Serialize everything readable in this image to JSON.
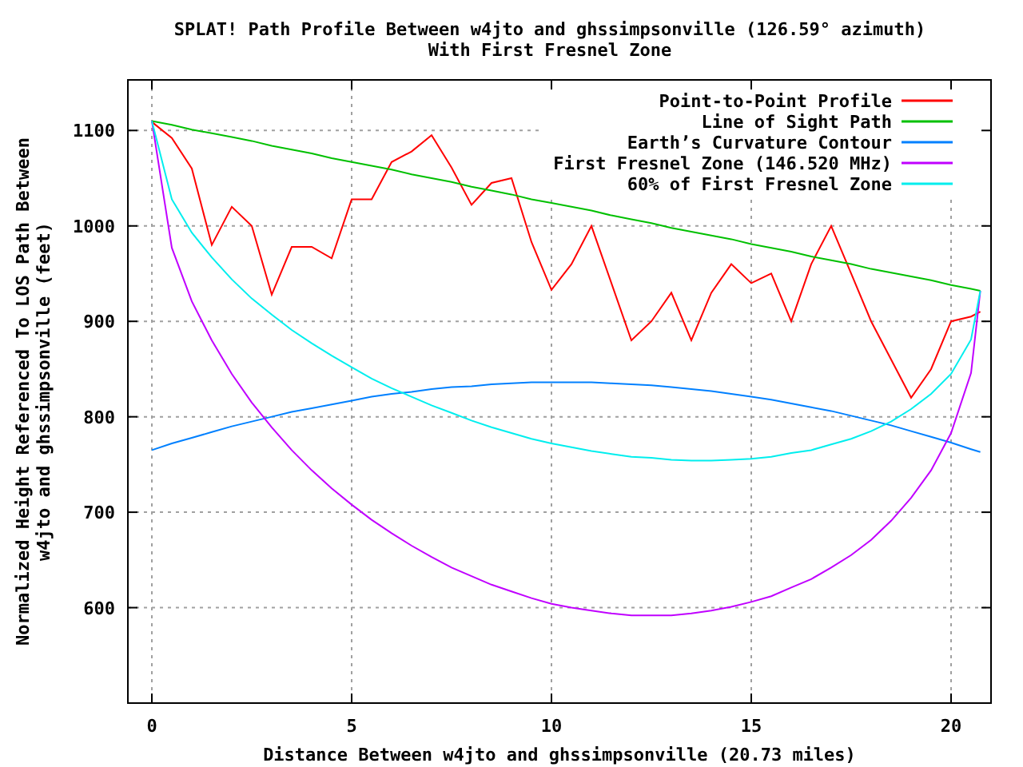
{
  "chart_data": {
    "type": "line",
    "title": "SPLAT! Path Profile Between w4jto and ghssimpsonville (126.59° azimuth)\nWith First Fresnel Zone",
    "xlabel": "Distance Between w4jto and ghssimpsonville (20.73 miles)",
    "ylabel": "Normalized Height Referenced To LOS Path Between\nw4jto and ghssimpsonville (feet)",
    "x": [
      0,
      0.5,
      1,
      1.5,
      2,
      2.5,
      3,
      3.5,
      4,
      4.5,
      5,
      5.5,
      6,
      6.5,
      7,
      7.5,
      8,
      8.5,
      9,
      9.5,
      10,
      10.5,
      11,
      11.5,
      12,
      12.5,
      13,
      13.5,
      14,
      14.5,
      15,
      15.5,
      16,
      16.5,
      17,
      17.5,
      18,
      18.5,
      19,
      19.5,
      20,
      20.5,
      20.73
    ],
    "series": [
      {
        "name": "Point-to-Point Profile",
        "color": "#ff0000",
        "values": [
          1109,
          1092,
          1060,
          980,
          1020,
          1000,
          928,
          978,
          978,
          966,
          1028,
          1028,
          1067,
          1078,
          1095,
          1061,
          1022,
          1045,
          1050,
          983,
          933,
          960,
          1000,
          940,
          880,
          900,
          930,
          880,
          930,
          960,
          940,
          950,
          900,
          960,
          1000,
          950,
          900,
          860,
          820,
          850,
          900,
          905,
          910
        ]
      },
      {
        "name": "Line of Sight Path",
        "color": "#00c000",
        "values": [
          1110,
          1106,
          1101,
          1097,
          1093,
          1089,
          1084,
          1080,
          1076,
          1071,
          1067,
          1063,
          1059,
          1054,
          1050,
          1046,
          1041,
          1037,
          1033,
          1028,
          1024,
          1020,
          1016,
          1011,
          1007,
          1003,
          998,
          994,
          990,
          986,
          981,
          977,
          973,
          968,
          964,
          960,
          955,
          951,
          947,
          943,
          938,
          934,
          932
        ]
      },
      {
        "name": "Earth’s Curvature Contour",
        "color": "#0080ff",
        "values": [
          765,
          772,
          778,
          784,
          790,
          795,
          800,
          805,
          809,
          813,
          817,
          821,
          824,
          826,
          829,
          831,
          832,
          834,
          835,
          836,
          836,
          836,
          836,
          835,
          834,
          833,
          831,
          829,
          827,
          824,
          821,
          818,
          814,
          810,
          806,
          801,
          796,
          791,
          785,
          779,
          773,
          766,
          763
        ]
      },
      {
        "name": "First Fresnel Zone (146.520 MHz)",
        "color": "#c000ff",
        "values": [
          1110,
          977,
          921,
          880,
          845,
          815,
          789,
          765,
          744,
          725,
          708,
          692,
          678,
          665,
          653,
          642,
          633,
          624,
          617,
          610,
          604,
          600,
          597,
          594,
          592,
          592,
          592,
          594,
          597,
          601,
          606,
          612,
          621,
          630,
          642,
          655,
          671,
          691,
          715,
          744,
          783,
          846,
          932
        ]
      },
      {
        "name": "60% of First Fresnel Zone",
        "color": "#00eeee",
        "values": [
          1110,
          1028,
          993,
          967,
          944,
          924,
          907,
          891,
          877,
          864,
          852,
          840,
          830,
          821,
          812,
          804,
          796,
          789,
          783,
          777,
          772,
          768,
          764,
          761,
          758,
          757,
          755,
          754,
          754,
          755,
          756,
          758,
          762,
          765,
          771,
          777,
          785,
          795,
          808,
          824,
          845,
          881,
          932
        ]
      }
    ],
    "xlim": [
      -0.6,
      21
    ],
    "ylim": [
      500,
      1153
    ],
    "grid": true,
    "legend": true,
    "xticks": [
      0,
      5,
      10,
      15,
      20
    ],
    "yticks": [
      600,
      700,
      800,
      900,
      1000,
      1100
    ]
  }
}
